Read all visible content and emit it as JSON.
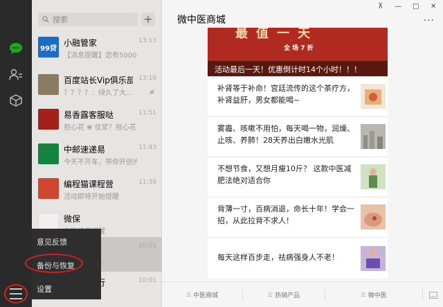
{
  "window": {
    "pin_glyph": "⊼",
    "minimize_glyph": "—",
    "maximize_glyph": "□",
    "close_glyph": "✕"
  },
  "sidebar": {
    "icons": [
      "chat-bubble-icon",
      "contacts-icon",
      "favorites-box-icon"
    ],
    "active_color": "#1aad19",
    "menu_icon": "hamburger-menu-icon"
  },
  "search": {
    "placeholder": "搜索",
    "add_label": "+"
  },
  "chats": [
    {
      "name": "小融管家",
      "preview": "【消息提醒】您有5000...",
      "time": "13:13",
      "avatar_text": "99贷",
      "avatar_color": "#1a6cc6"
    },
    {
      "name": "百度站长Vip俱乐部",
      "preview": "？？？？：绿久了大...",
      "time": "13:10",
      "avatar_text": "",
      "avatar_color": "#8a7a62",
      "muted": true
    },
    {
      "name": "易香露客服哒",
      "preview": "担心花 ❀ 仗浆？担心花 ❀ ...",
      "time": "11:51",
      "avatar_text": "",
      "avatar_color": "#a4201a"
    },
    {
      "name": "中邮速递易",
      "preview": "今天不开车，带你开创光机",
      "time": "11:43",
      "avatar_text": "",
      "avatar_color": "#14833f"
    },
    {
      "name": "编程猫课程营",
      "preview": "活动即将开始提醒",
      "time": "11:39",
      "avatar_text": "",
      "avatar_color": "#d0452e"
    },
    {
      "name": "微保",
      "preview": "车险续保提醒",
      "time": "",
      "avatar_text": "",
      "avatar_color": "#f0f0f0"
    },
    {
      "name": "",
      "preview": "：优惠倒计...",
      "time": "10:01",
      "avatar_text": "",
      "avatar_color": "#cac8c6",
      "selected": true
    },
    {
      "name": "行电子银行",
      "preview": "抢购2019...",
      "time": "10:01",
      "avatar_text": "",
      "avatar_color": "#e6e5e4"
    }
  ],
  "popup_menu": {
    "items": [
      "意见反馈",
      "备份与恢复",
      "设置"
    ]
  },
  "main": {
    "title": "微中医商城",
    "more_label": "···",
    "banner_big": "最值一天",
    "banner_sale": "全 场 7 折",
    "banner_caption": "活动最后一天！优惠倒计时14个小时！！！",
    "articles": [
      {
        "text": "补肾等于补命！宫廷流传的这个茶疗方，补肾益肝，男女都能喝~",
        "thumb": "tea-box-thumbnail"
      },
      {
        "text": "雾霾、咳嗽不用怕，每天喝一物，润燥、止咳、养肺！28天养出白嫩水光肌",
        "thumb": "smog-city-thumbnail"
      },
      {
        "text": "不想节食，又想月瘦10斤？ 这款中医减肥法绝对适合你",
        "thumb": "slim-woman-thumbnail"
      },
      {
        "text": "背薄一寸，百病消退，命长十年！学会一招，从此拉背不求人！",
        "thumb": "back-massage-thumbnail"
      },
      {
        "text": "每天这样百步走，祛病强身人不老！",
        "thumb": "walking-thumbnail"
      }
    ],
    "tabs": [
      "中医商城",
      "热销产品",
      "微中医"
    ],
    "keyboard_icon": "keyboard-switch-icon"
  }
}
